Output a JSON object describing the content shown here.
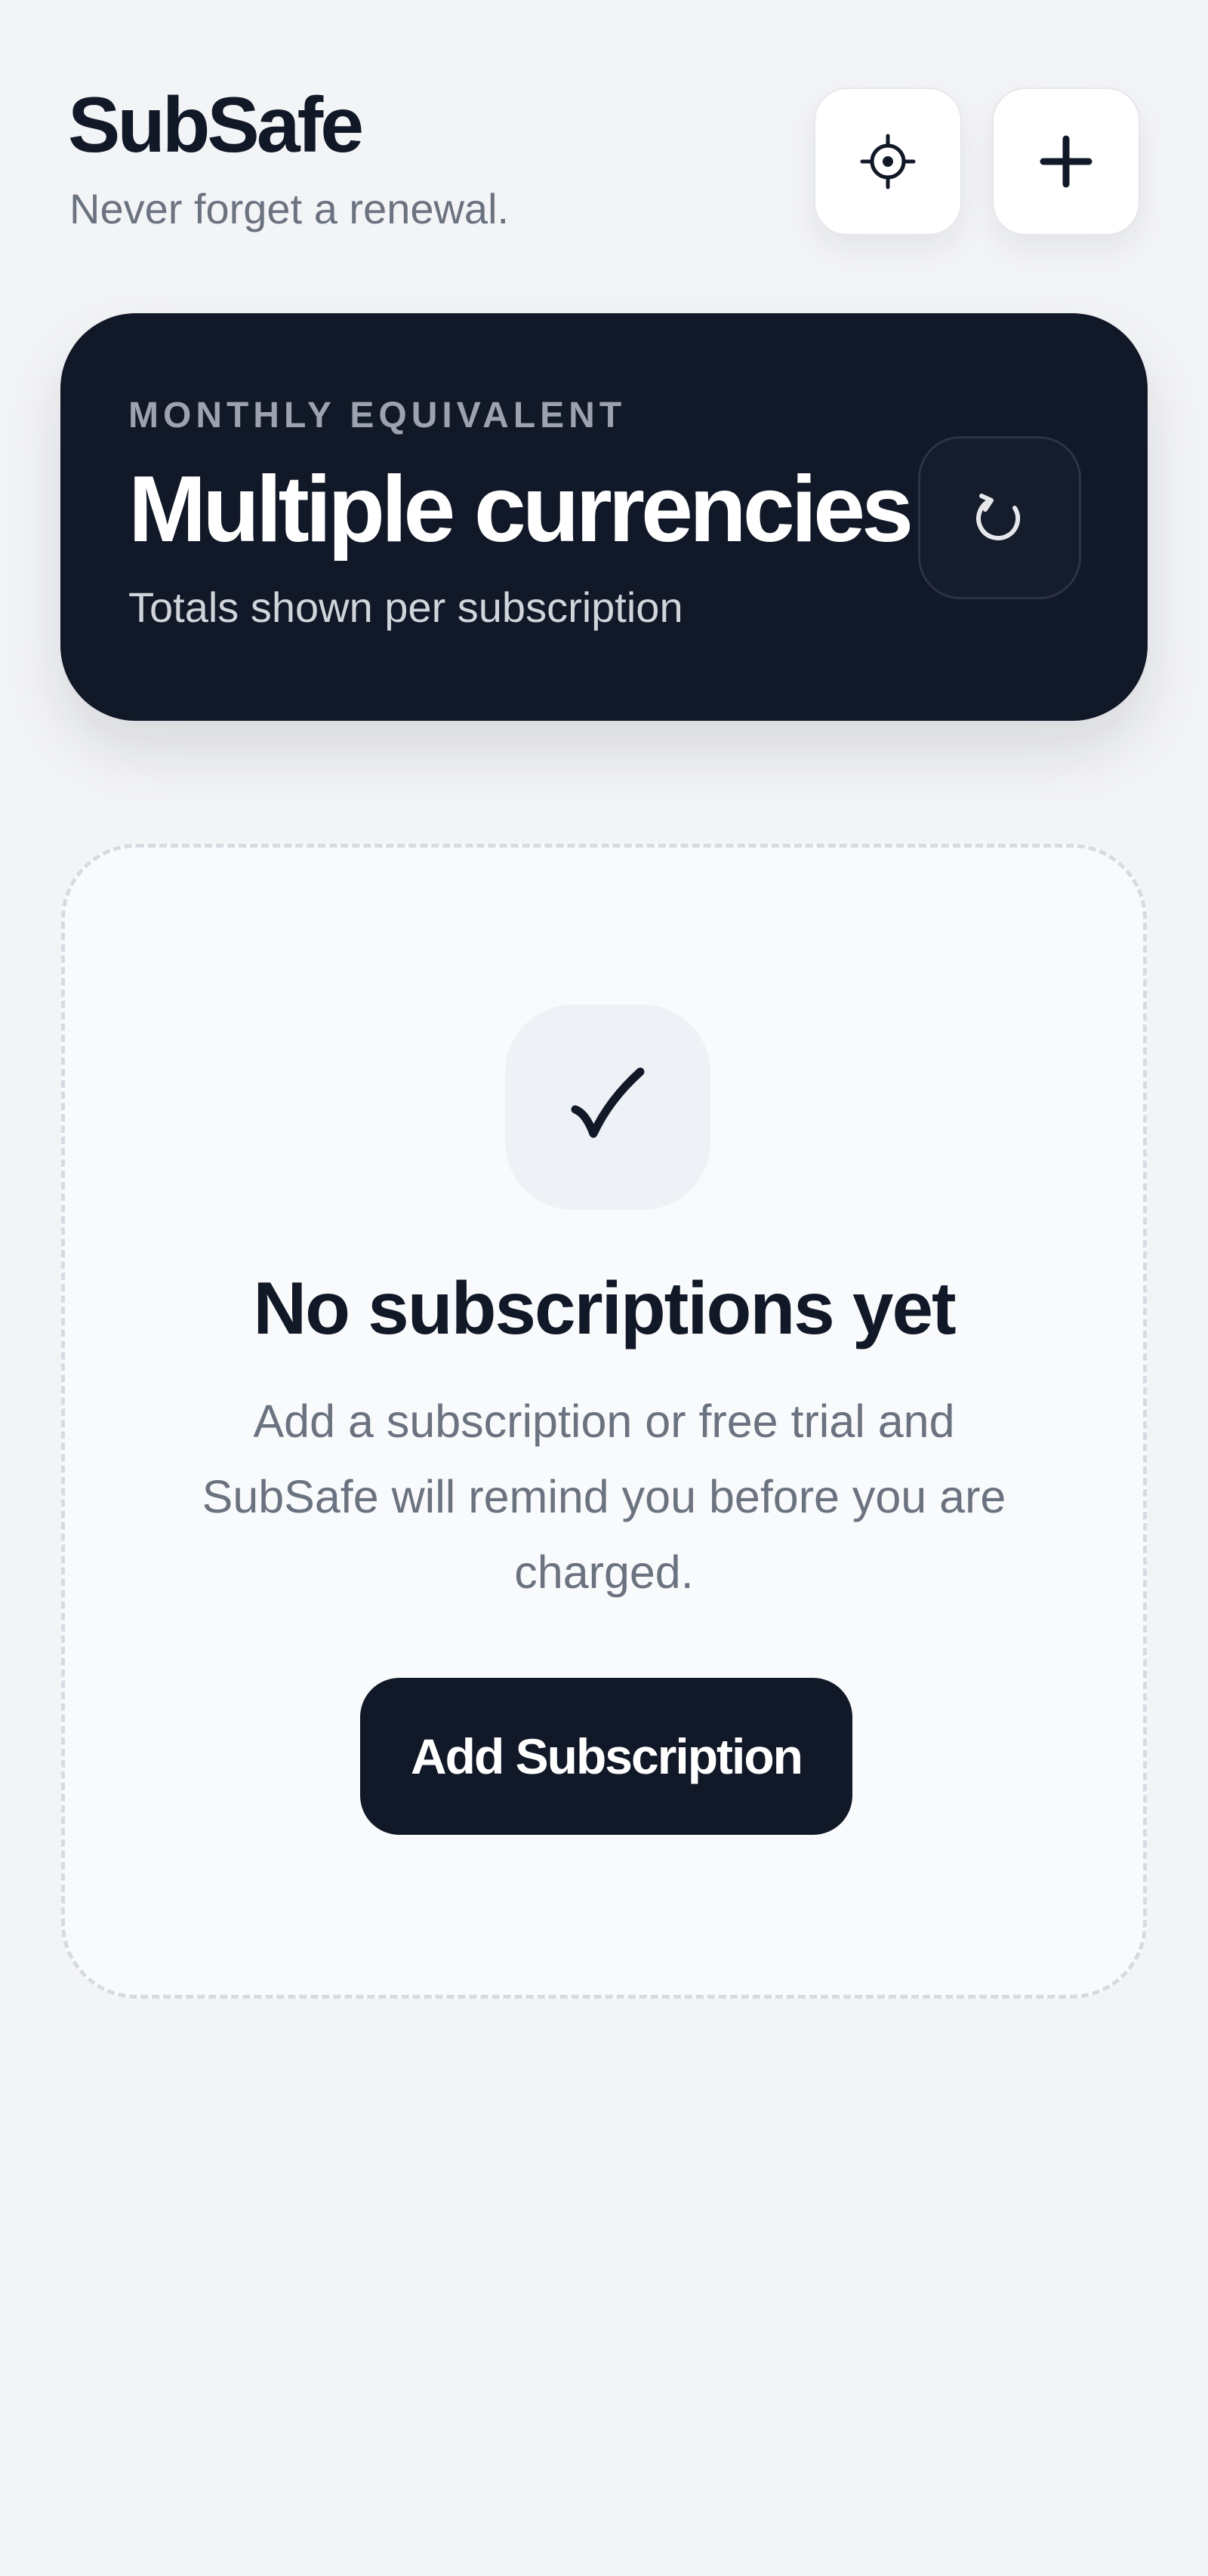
{
  "header": {
    "title": "SubSafe",
    "subtitle": "Never forget a renewal.",
    "settings_icon": "gear-icon",
    "add_icon": "plus-icon"
  },
  "summary": {
    "eyebrow": "MONTHLY EQUIVALENT",
    "value": "Multiple currencies",
    "note": "Totals shown per subscription",
    "refresh_icon": "refresh-icon"
  },
  "empty_state": {
    "icon": "checkmark-icon",
    "title": "No subscriptions yet",
    "description": "Add a subscription or free trial and SubSafe will remind you before you are charged.",
    "button_label": "Add Subscription"
  },
  "colors": {
    "background": "#f3f4f6",
    "dark_surface": "#111827",
    "muted_text": "#6b7280",
    "card_surface": "#ffffff"
  }
}
